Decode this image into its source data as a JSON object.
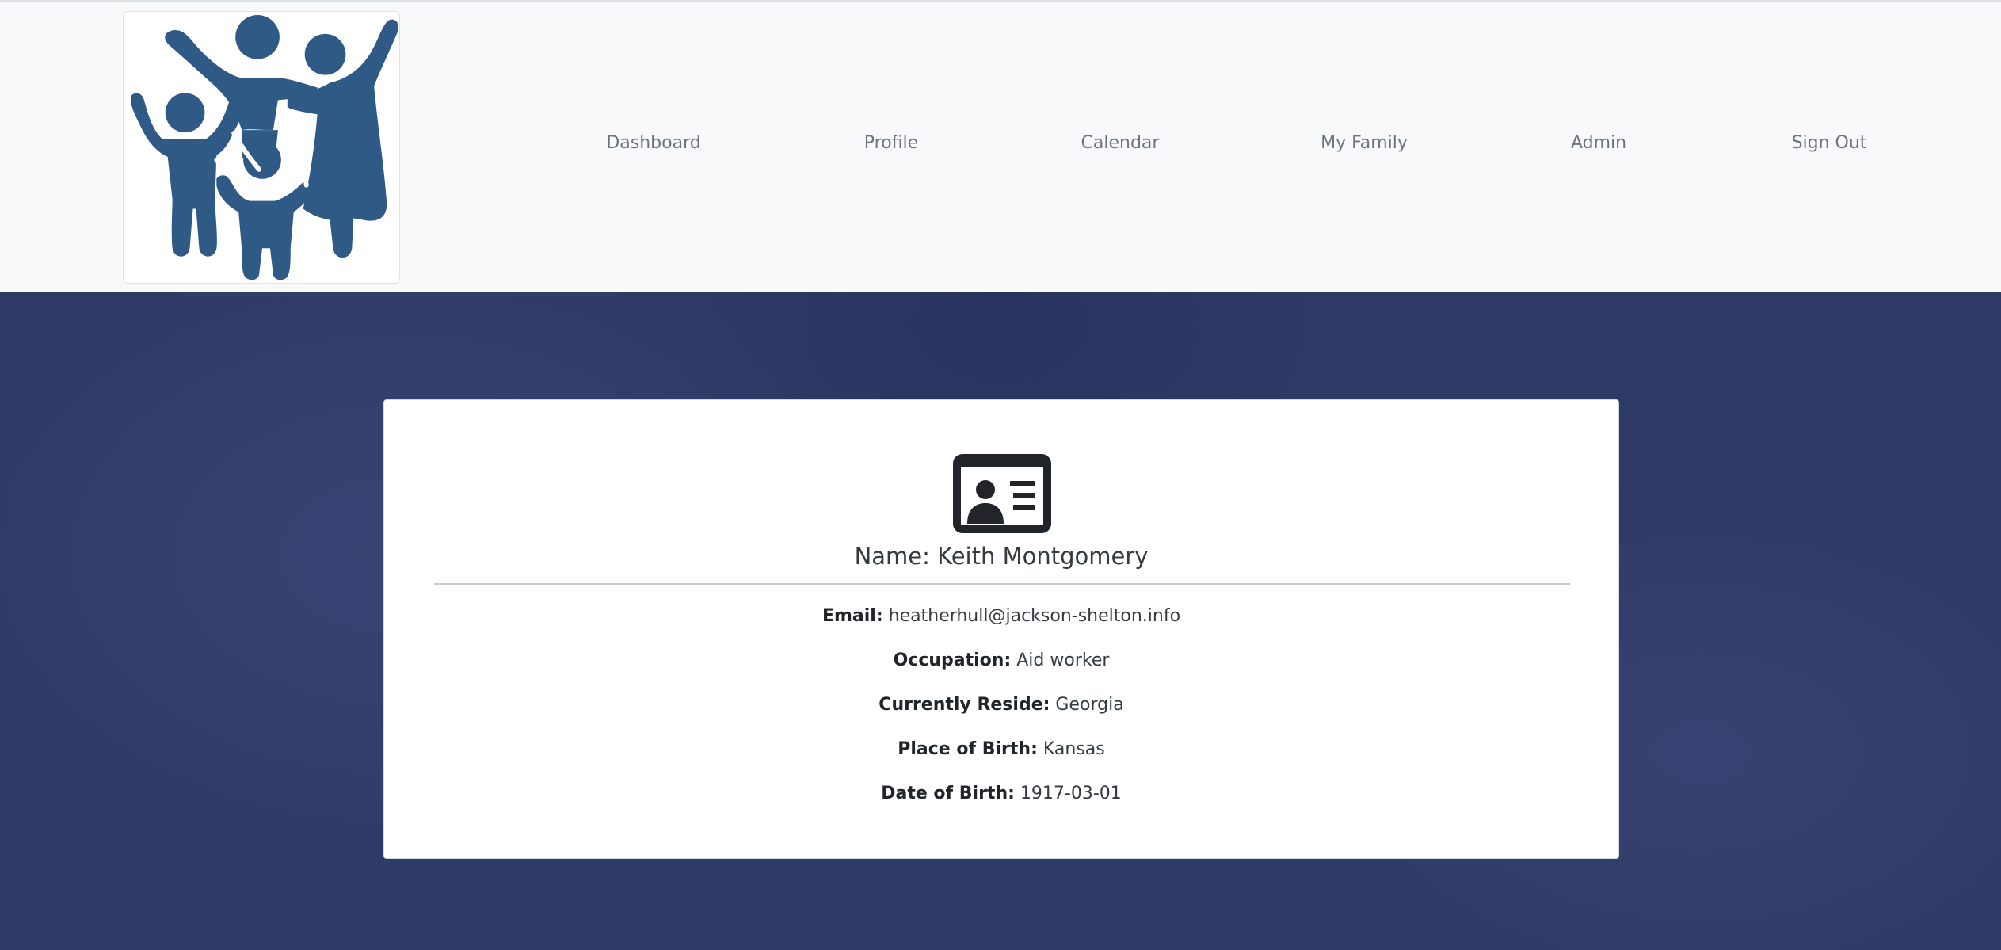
{
  "nav": {
    "logo_alt": "family logo",
    "links": [
      {
        "label": "Dashboard"
      },
      {
        "label": "Profile"
      },
      {
        "label": "Calendar"
      },
      {
        "label": "My Family"
      },
      {
        "label": "Admin"
      },
      {
        "label": "Sign Out"
      }
    ]
  },
  "profile": {
    "icon": "id-card-icon",
    "name_label": "Name:",
    "name_value": "Keith Montgomery",
    "fields": [
      {
        "label": "Email:",
        "value": "heatherhull@jackson-shelton.info"
      },
      {
        "label": "Occupation:",
        "value": "Aid worker"
      },
      {
        "label": "Currently Reside:",
        "value": "Georgia"
      },
      {
        "label": "Place of Birth:",
        "value": "Kansas"
      },
      {
        "label": "Date of Birth:",
        "value": "1917-03-01"
      }
    ]
  },
  "colors": {
    "navbar_bg": "#f8f9fa",
    "main_bg": "#2e3a66",
    "logo_fill": "#2f5a86",
    "nav_text": "#6c757d",
    "card_bg": "#ffffff",
    "icon_color": "#212529"
  }
}
